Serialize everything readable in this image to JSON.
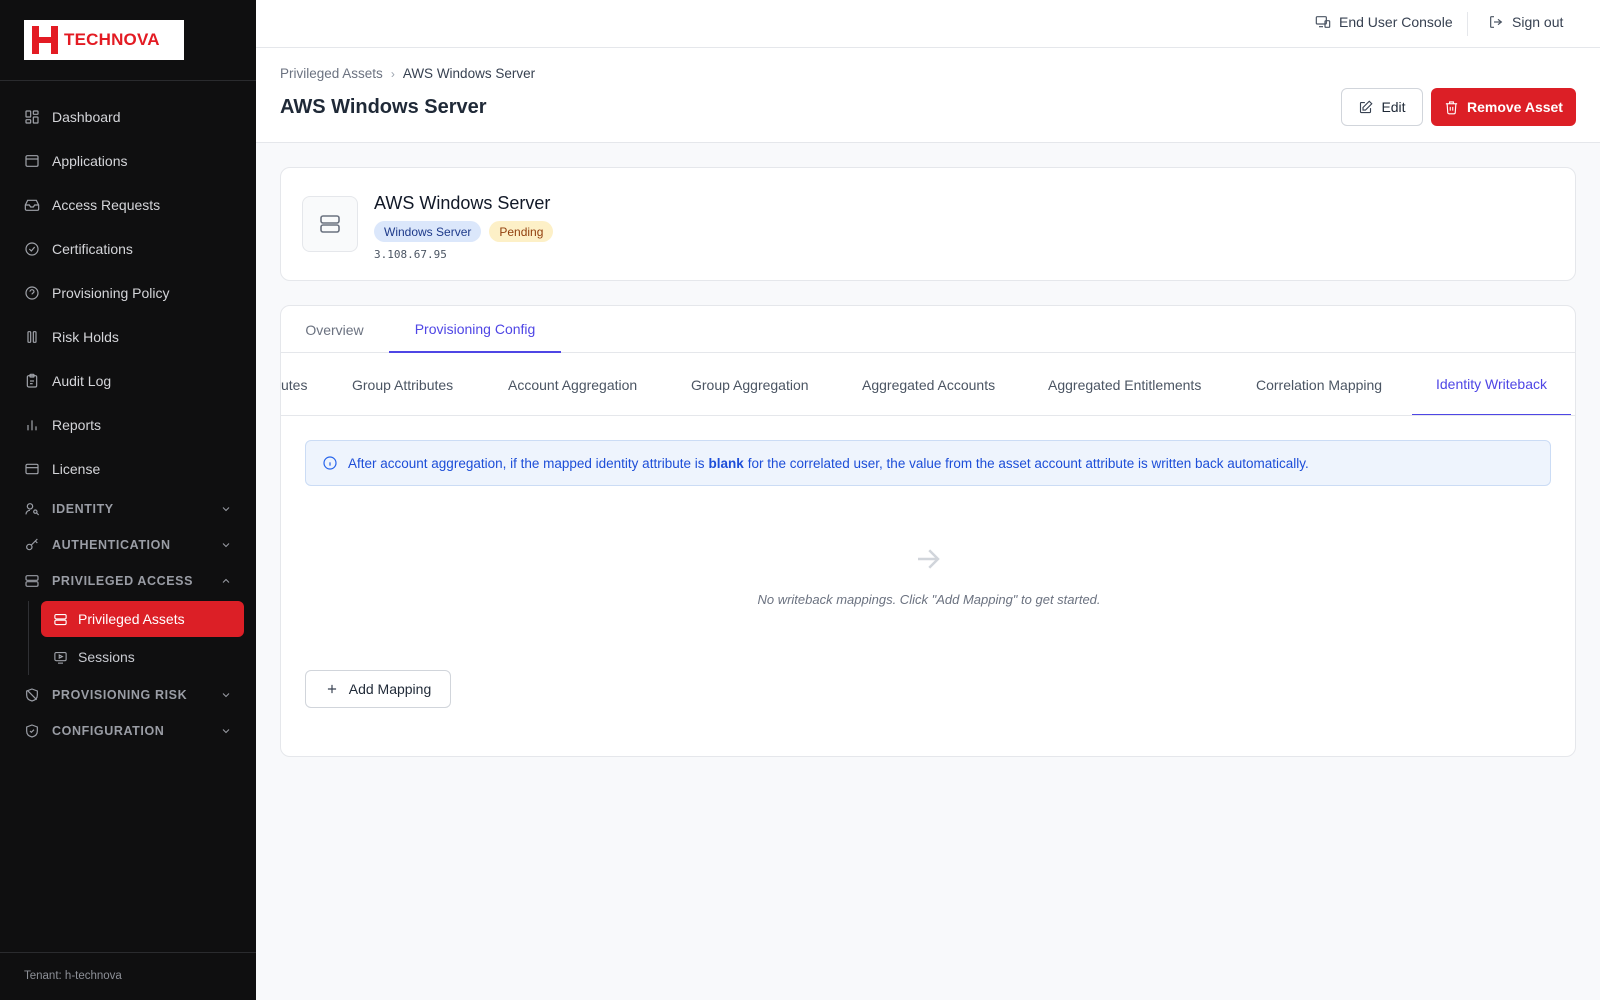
{
  "brand": {
    "name": "TECHNOVA",
    "accent": "#dc1f26"
  },
  "sidebar": {
    "items": [
      {
        "label": "Dashboard",
        "icon": "grid-icon"
      },
      {
        "label": "Applications",
        "icon": "window-icon"
      },
      {
        "label": "Access Requests",
        "icon": "inbox-icon"
      },
      {
        "label": "Certifications",
        "icon": "check-circle-icon"
      },
      {
        "label": "Provisioning Policy",
        "icon": "policy-icon"
      },
      {
        "label": "Risk Holds",
        "icon": "pause-icon"
      },
      {
        "label": "Audit Log",
        "icon": "clipboard-icon"
      },
      {
        "label": "Reports",
        "icon": "bar-chart-icon"
      },
      {
        "label": "License",
        "icon": "card-icon"
      }
    ],
    "sections": {
      "identity": "IDENTITY",
      "authentication": "AUTHENTICATION",
      "privileged_access": "PRIVILEGED ACCESS",
      "provisioning_risk": "PROVISIONING RISK",
      "configuration": "CONFIGURATION"
    },
    "privileged_sub": [
      {
        "label": "Privileged Assets",
        "active": true
      },
      {
        "label": "Sessions",
        "active": false
      }
    ],
    "tenant": "Tenant: h-technova"
  },
  "topbar": {
    "console": "End User Console",
    "signout": "Sign out"
  },
  "header": {
    "breadcrumb_parent": "Privileged Assets",
    "breadcrumb_current": "AWS Windows Server",
    "title": "AWS Windows Server",
    "edit_label": "Edit",
    "remove_label": "Remove Asset"
  },
  "asset": {
    "name": "AWS Windows Server",
    "type_badge": "Windows Server",
    "status_badge": "Pending",
    "ip": "3.108.67.95"
  },
  "tabs": {
    "main": [
      {
        "label": "Overview",
        "active": false
      },
      {
        "label": "Provisioning Config",
        "active": true
      }
    ],
    "sub": [
      {
        "label": "utes",
        "active": false
      },
      {
        "label": "Group Attributes",
        "active": false
      },
      {
        "label": "Account Aggregation",
        "active": false
      },
      {
        "label": "Group Aggregation",
        "active": false
      },
      {
        "label": "Aggregated Accounts",
        "active": false
      },
      {
        "label": "Aggregated Entitlements",
        "active": false
      },
      {
        "label": "Correlation Mapping",
        "active": false
      },
      {
        "label": "Identity Writeback",
        "active": true
      }
    ]
  },
  "writeback": {
    "info_before": "After account aggregation, if the mapped identity attribute is",
    "info_bold": "blank",
    "info_after": "for the correlated user, the value from the asset account attribute is written back automatically.",
    "empty_text": "No writeback mappings. Click \"Add Mapping\" to get started.",
    "add_label": "Add Mapping"
  }
}
